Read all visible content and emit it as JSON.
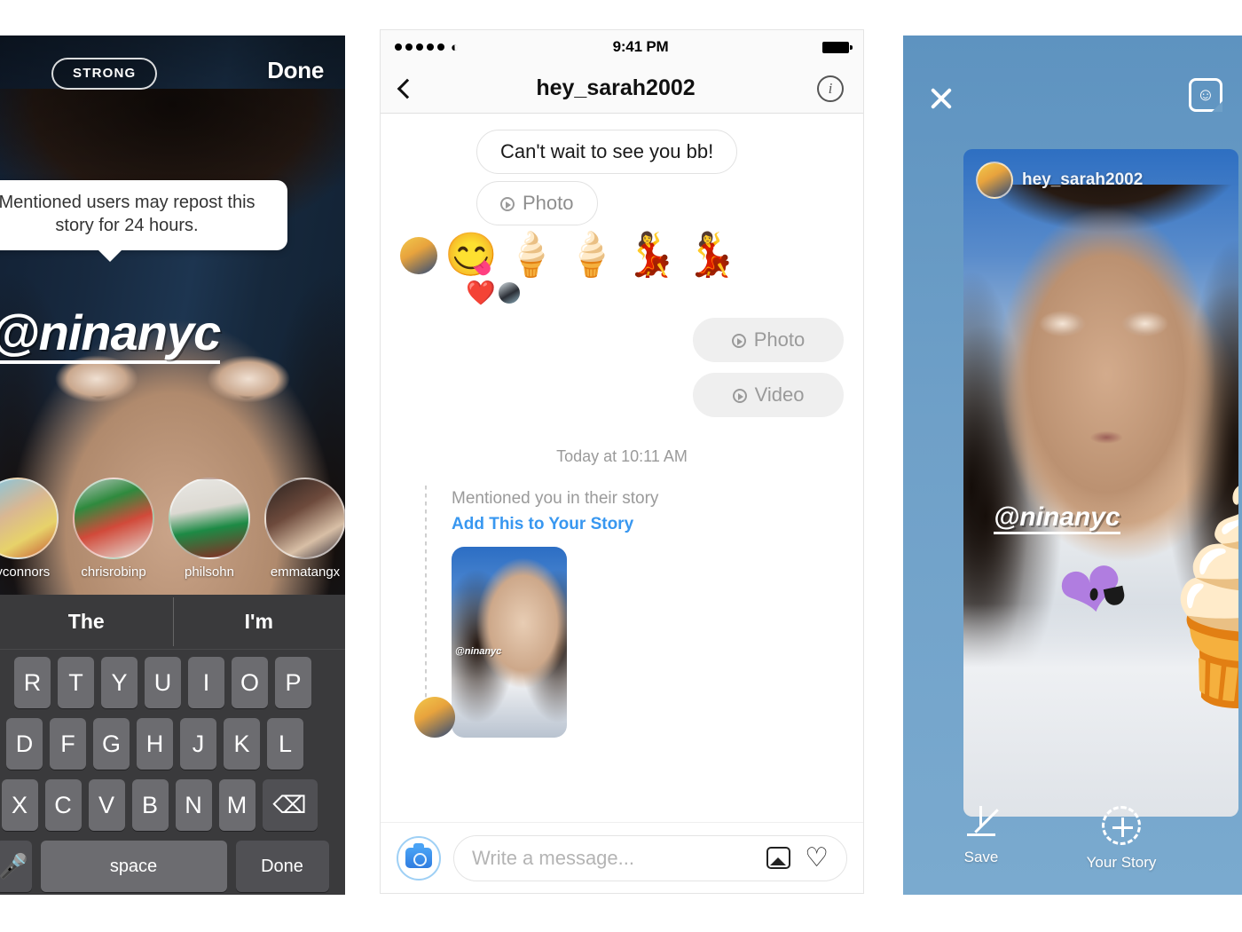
{
  "left_panel": {
    "privacy_badge": "STRONG",
    "done_button": "Done",
    "tooltip_text": "Mentioned users may repost this story for 24 hours.",
    "mention_overlay": "@ninanyc",
    "friends": [
      {
        "name": "jayconnors"
      },
      {
        "name": "chrisrobinp"
      },
      {
        "name": "philsohn"
      },
      {
        "name": "emmatangx"
      }
    ],
    "keyboard": {
      "suggestions": [
        "The",
        "I'm"
      ],
      "row1": [
        "R",
        "T",
        "Y",
        "U",
        "I",
        "O",
        "P"
      ],
      "row2": [
        "D",
        "F",
        "G",
        "H",
        "J",
        "K",
        "L"
      ],
      "row3": [
        "X",
        "C",
        "V",
        "B",
        "N",
        "M"
      ],
      "backspace_icon": "backspace-icon",
      "mic_icon": "microphone-icon",
      "space_label": "space",
      "done_label": "Done"
    }
  },
  "mid_panel": {
    "status_bar": {
      "signal_icon": "signal-dots-icon",
      "wifi_icon": "wifi-icon",
      "time": "9:41 PM",
      "battery_icon": "battery-full-icon"
    },
    "nav": {
      "back_icon": "chevron-left-icon",
      "title": "hey_sarah2002",
      "info_icon": "info-circle-icon"
    },
    "messages": [
      {
        "type": "incoming-text",
        "text": "Can't wait to see you bb!"
      },
      {
        "type": "incoming-media",
        "text": "Photo",
        "icon": "play-circle-icon"
      }
    ],
    "emoji_row": [
      "😋",
      "🍦",
      "🍦",
      "💃",
      "💃"
    ],
    "reaction": {
      "emoji": "❤️"
    },
    "outgoing": [
      {
        "text": "Photo",
        "icon": "play-circle-icon"
      },
      {
        "text": "Video",
        "icon": "play-circle-icon"
      }
    ],
    "timestamp": "Today at 10:11 AM",
    "mention_card": {
      "label": "Mentioned you in their story",
      "link": "Add This to Your Story",
      "thumb_overlay": "@ninanyc"
    },
    "composer": {
      "camera_icon": "camera-icon",
      "placeholder": "Write a message...",
      "gallery_icon": "gallery-icon",
      "heart_icon": "heart-outline-icon"
    }
  },
  "right_panel": {
    "close_icon": "close-x-icon",
    "sticker_icon": "sticker-face-icon",
    "story_username": "hey_sarah2002",
    "mention_overlay": "@ninanyc",
    "heart_sticker": "winking-heart-sticker",
    "cone_sticker": "🍦",
    "actions": [
      {
        "label": "Save",
        "icon": "download-arrow-icon"
      },
      {
        "label": "Your Story",
        "icon": "add-to-story-icon"
      }
    ],
    "accent_color": "#6fa0c8"
  }
}
